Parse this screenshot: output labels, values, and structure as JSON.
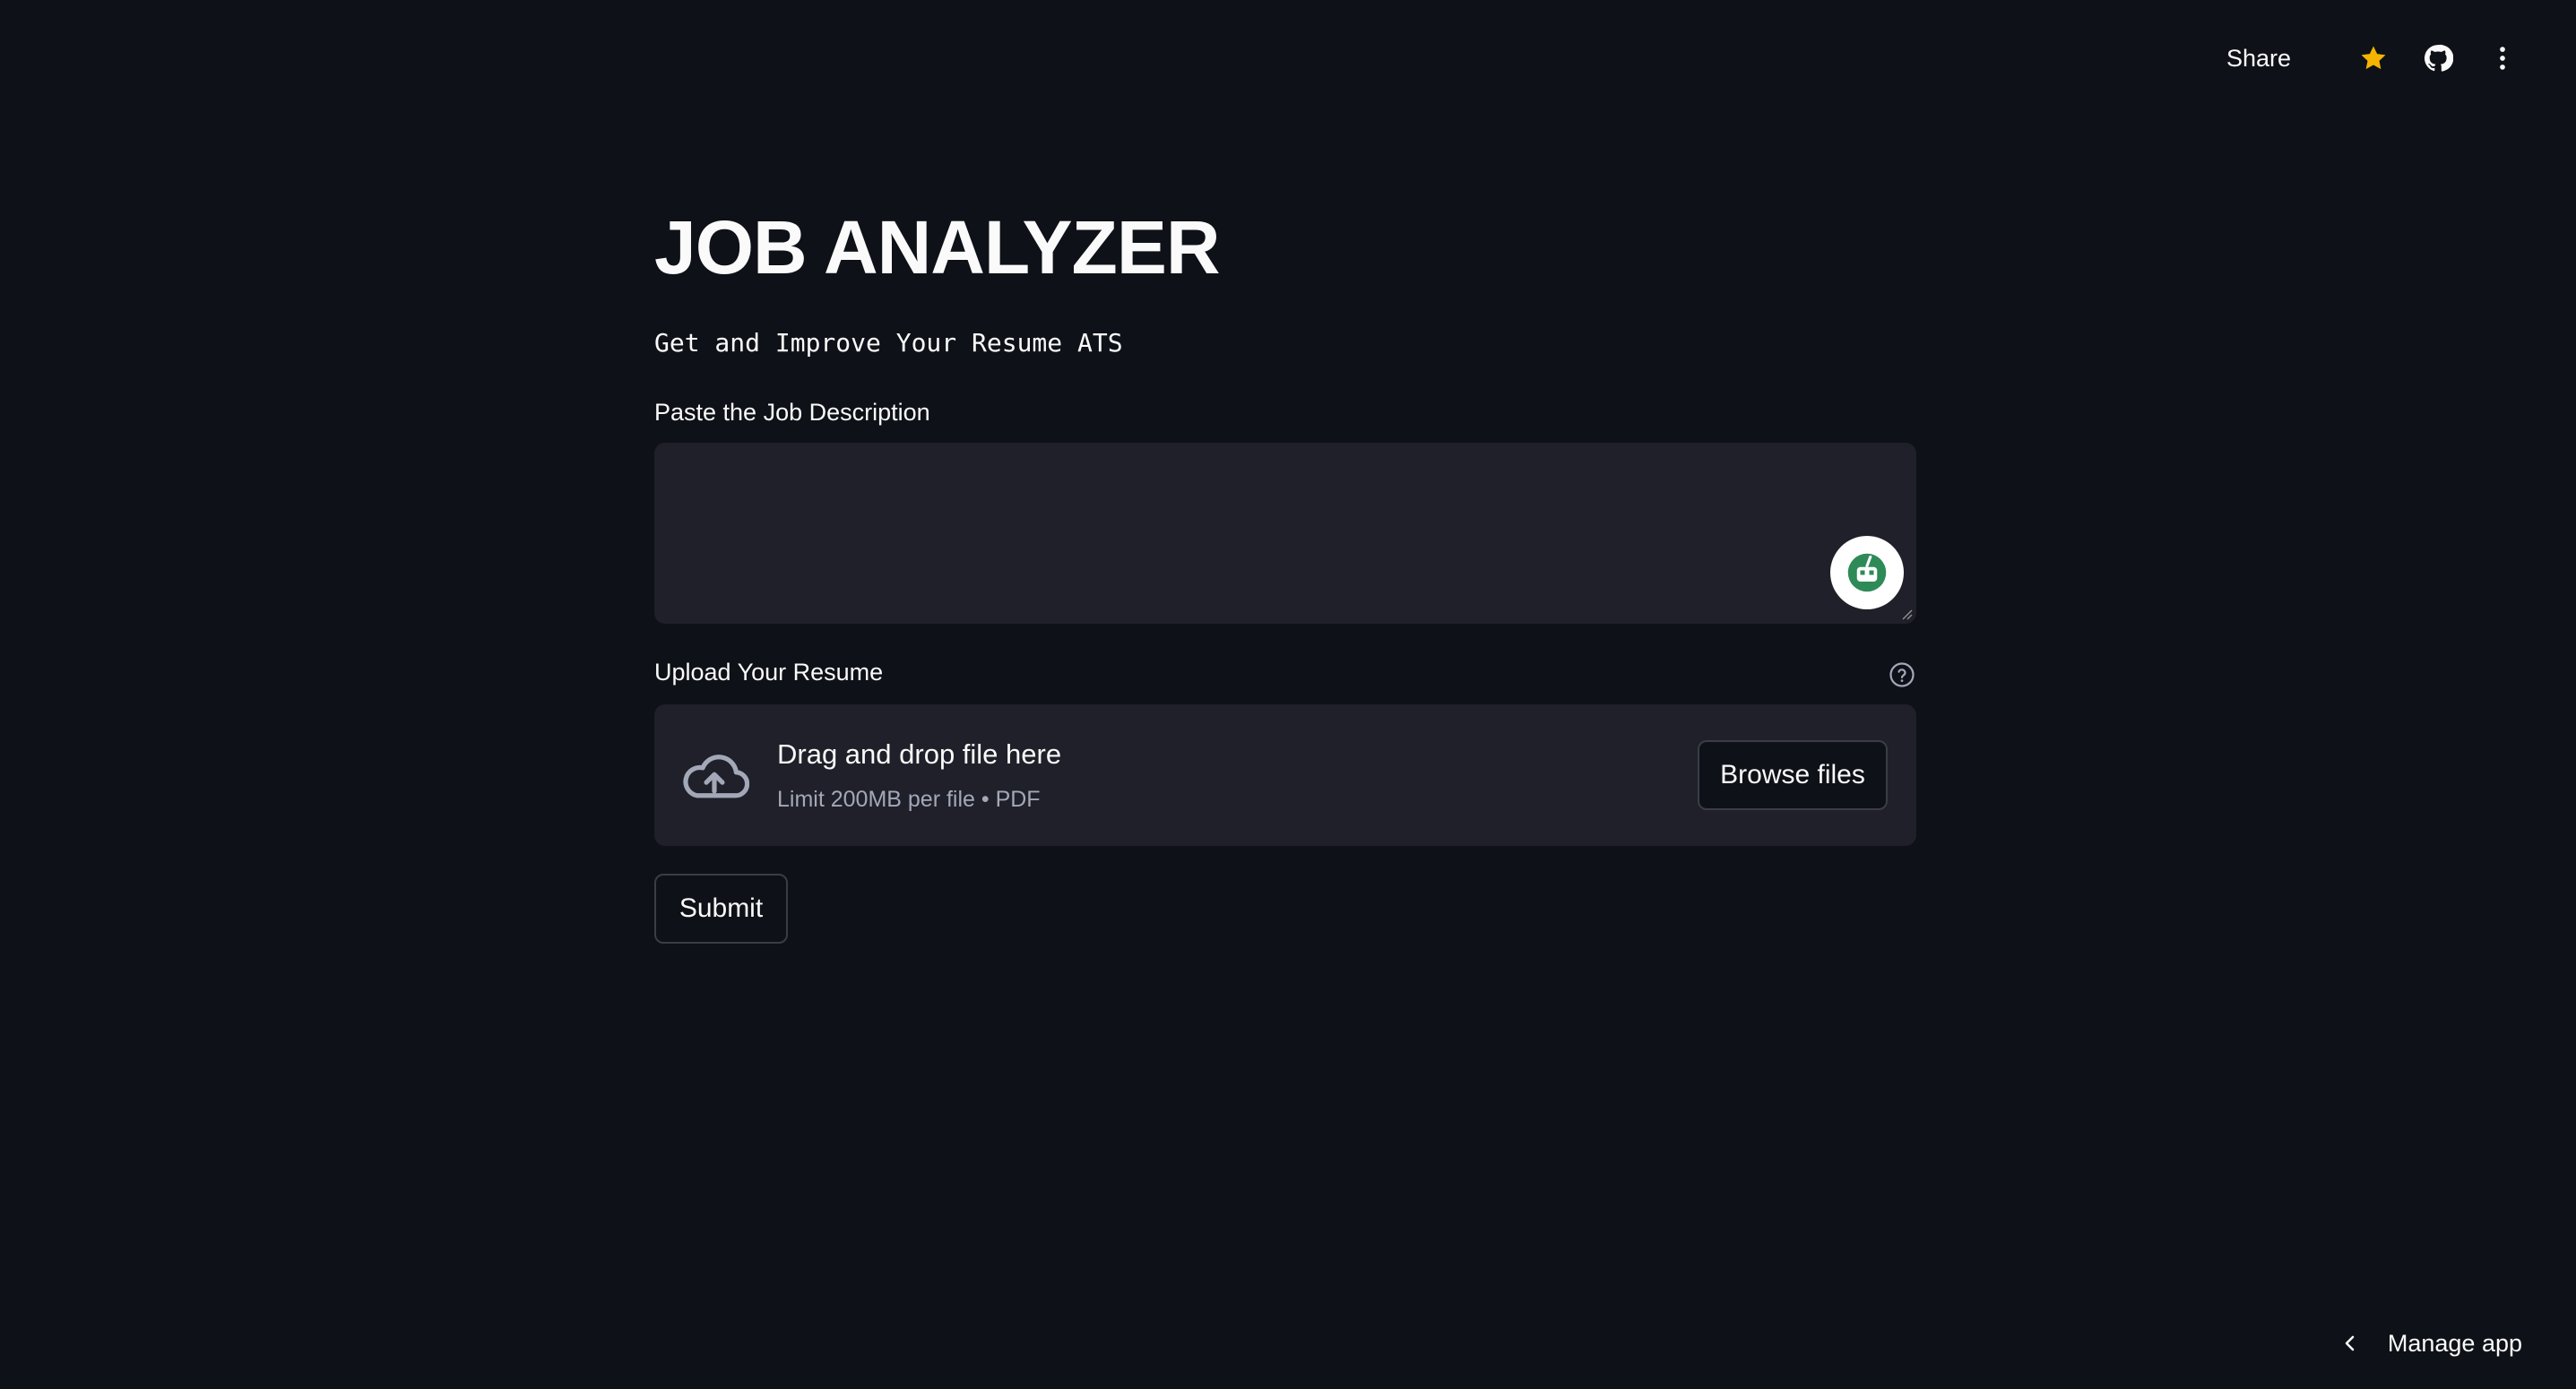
{
  "header": {
    "share_label": "Share",
    "icons": [
      "star-icon",
      "github-icon",
      "more-vertical-icon"
    ],
    "star_color": "#f5b400"
  },
  "main": {
    "title": "JOB ANALYZER",
    "subtitle": "Get and Improve Your Resume ATS",
    "job_description": {
      "label": "Paste the Job Description",
      "value": "",
      "placeholder": ""
    },
    "upload": {
      "label": "Upload Your Resume",
      "dropzone_title": "Drag and drop file here",
      "dropzone_limit": "Limit 200MB per file • PDF",
      "browse_label": "Browse files"
    },
    "submit_label": "Submit"
  },
  "footer": {
    "manage_app_label": "Manage app"
  },
  "colors": {
    "background": "#0e1117",
    "input_background": "#1f2029",
    "text": "#fafafa",
    "muted_text": "#a3a8b8",
    "grammarly_green": "#15c39a"
  }
}
